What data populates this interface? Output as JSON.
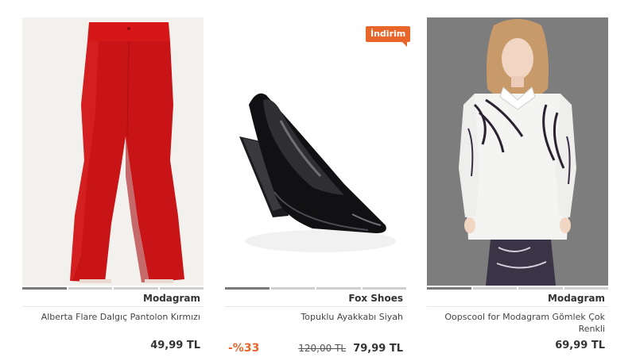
{
  "products": [
    {
      "brand": "Modagram",
      "title": "Alberta Flare Dalgıç Pantolon Kırmızı",
      "price": "49,99 TL",
      "image_alt": "red-flare-pants"
    },
    {
      "brand": "Fox Shoes",
      "title": "Topuklu Ayakkabı Siyah",
      "old_price": "120,00 TL",
      "price": "79,99 TL",
      "discount": "-%33",
      "badge": "İndirim",
      "image_alt": "black-wedge-shoe"
    },
    {
      "brand": "Modagram",
      "title": "Oopscool for Modagram Gömlek Çok Renkli",
      "price": "69,99 TL",
      "image_alt": "patterned-shirt"
    }
  ],
  "colors": {
    "accent": "#e8662a",
    "text": "#333333",
    "slider_active": "#7a7a7a",
    "slider_inactive": "#cfcfcf"
  }
}
